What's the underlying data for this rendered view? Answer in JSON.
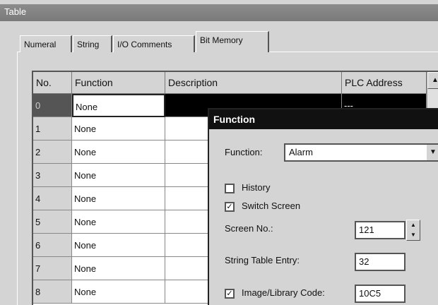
{
  "window": {
    "title": "Table"
  },
  "tabs": [
    {
      "label": "Numeral"
    },
    {
      "label": "String"
    },
    {
      "label": "I/O Comments"
    },
    {
      "label": "Bit Memory",
      "active": true
    }
  ],
  "table": {
    "columns": [
      "No.",
      "Function",
      "Description",
      "PLC Address"
    ],
    "rows": [
      {
        "no": "0",
        "function": "None",
        "address": "---",
        "selected": true
      },
      {
        "no": "1",
        "function": "None"
      },
      {
        "no": "2",
        "function": "None"
      },
      {
        "no": "3",
        "function": "None"
      },
      {
        "no": "4",
        "function": "None"
      },
      {
        "no": "5",
        "function": "None"
      },
      {
        "no": "6",
        "function": "None"
      },
      {
        "no": "7",
        "function": "None"
      },
      {
        "no": "8",
        "function": "None"
      }
    ]
  },
  "dialog": {
    "title": "Function",
    "function_label": "Function:",
    "function_value": "Alarm",
    "history_label": "History",
    "history_checked": false,
    "switch_label": "Switch Screen",
    "switch_checked": true,
    "screen_no_label": "Screen No.:",
    "screen_no_value": "121",
    "string_table_label": "String Table Entry:",
    "string_table_value": "32",
    "image_lib_label": "Image/Library Code:",
    "image_lib_checked": true,
    "image_lib_value": "10C5"
  },
  "icons": {
    "dropdown": "chevron-down-icon",
    "spin_up": "arrow-up-icon",
    "spin_down": "arrow-down-icon",
    "check": "check-icon"
  }
}
